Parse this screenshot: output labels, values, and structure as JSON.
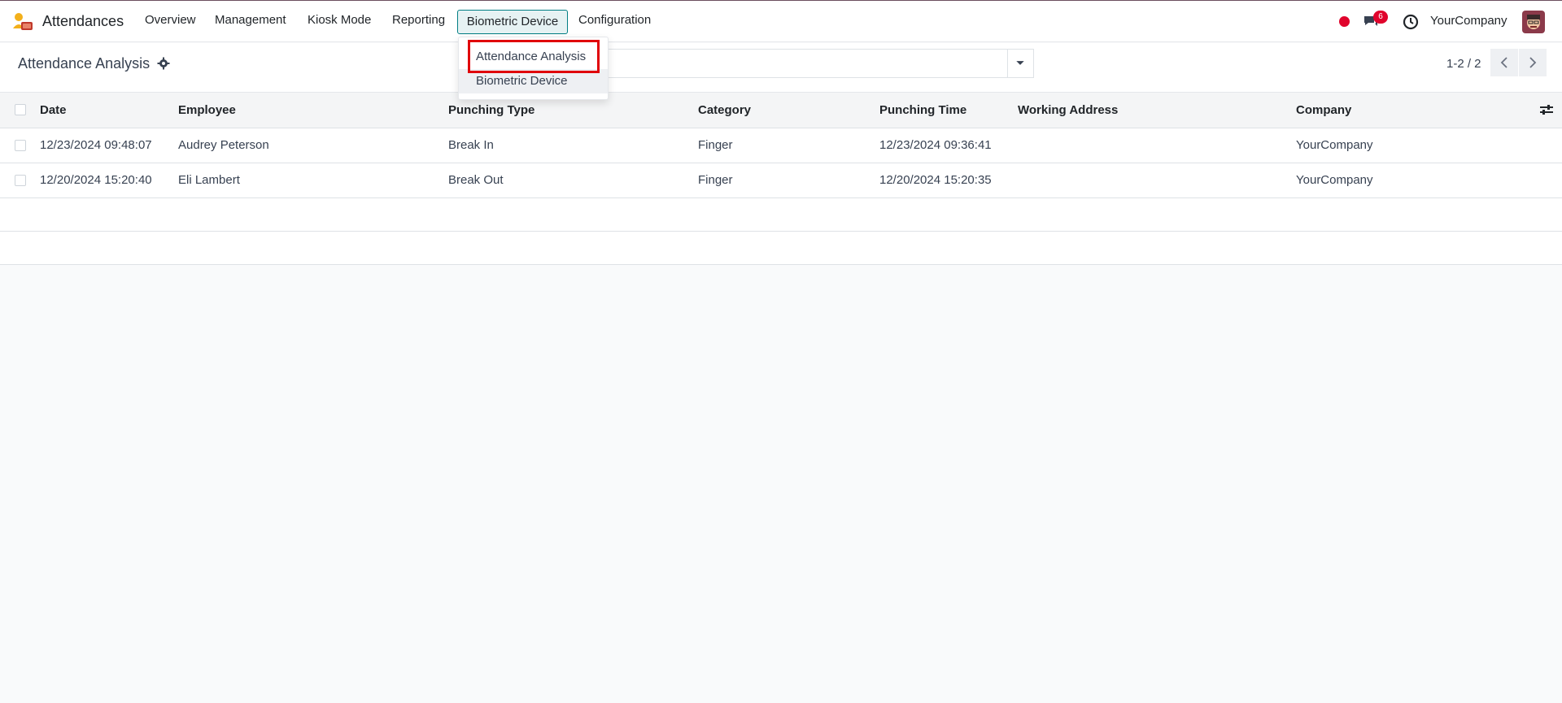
{
  "app": {
    "title": "Attendances"
  },
  "nav": {
    "items": [
      "Overview",
      "Management",
      "Kiosk Mode",
      "Reporting"
    ],
    "active": "Biometric Device",
    "configuration": "Configuration"
  },
  "systray": {
    "chat_count": "6",
    "company": "YourCompany"
  },
  "page": {
    "title": "Attendance Analysis"
  },
  "dropdown": {
    "items": [
      "Attendance Analysis",
      "Biometric Device"
    ]
  },
  "pager": {
    "text": "1-2 / 2"
  },
  "table": {
    "columns": [
      "Date",
      "Employee",
      "Punching Type",
      "Category",
      "Punching Time",
      "Working Address",
      "Company"
    ],
    "rows": [
      [
        "12/23/2024 09:48:07",
        "Audrey Peterson",
        "Break In",
        "Finger",
        "12/23/2024 09:36:41",
        "",
        "YourCompany"
      ],
      [
        "12/20/2024 15:20:40",
        "Eli Lambert",
        "Break Out",
        "Finger",
        "12/20/2024 15:20:35",
        "",
        "YourCompany"
      ]
    ]
  },
  "colors": {
    "accent": "#017e84",
    "badge": "#e0042c",
    "highlight": "#e0040b"
  },
  "icons": {
    "logo": "attendances-app-icon",
    "chat": "chat-icon",
    "clock": "clock-icon",
    "settings": "optional-columns-icon",
    "gear": "gear-icon"
  }
}
